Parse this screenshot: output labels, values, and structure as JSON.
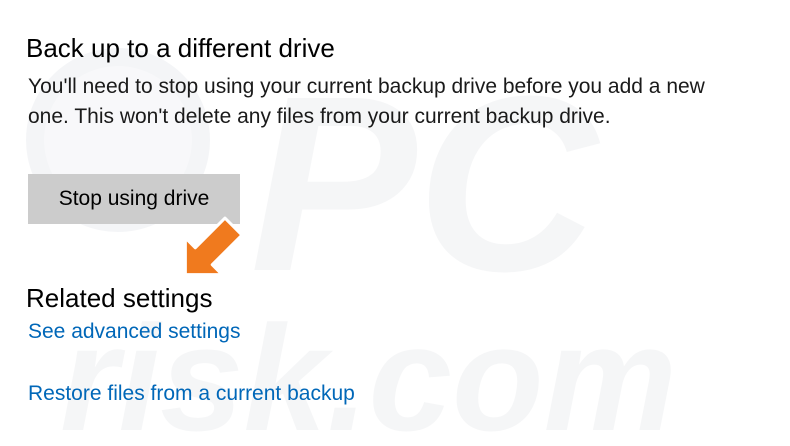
{
  "backup_section": {
    "title": "Back up to a different drive",
    "description": "You'll need to stop using your current backup drive before you add a new one. This won't delete any files from your current backup drive.",
    "stop_button_label": "Stop using drive"
  },
  "related_settings": {
    "title": "Related settings",
    "links": [
      {
        "label": "See advanced settings"
      },
      {
        "label": "Restore files from a current backup"
      }
    ]
  },
  "colors": {
    "link": "#0067b8",
    "button_bg": "#cccccc",
    "pointer_arrow": "#f07a1e"
  },
  "watermark": {
    "text_top": "PC",
    "text_bottom": "risk.com"
  },
  "icons": {
    "pointer": "arrow-pointer-icon"
  }
}
